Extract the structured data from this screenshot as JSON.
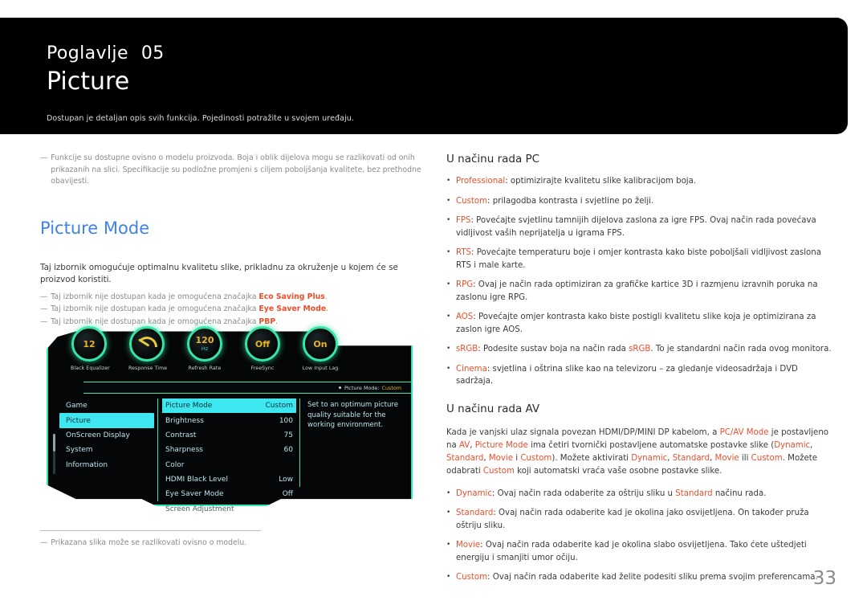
{
  "banner": {
    "chapter_label": "Poglavlje",
    "chapter_number": "05",
    "title": "Picture",
    "subtitle": "Dostupan je detaljan opis svih funkcija. Pojedinosti potražite u svojem uređaju."
  },
  "left": {
    "intro_note": "Funkcije su dostupne ovisno o modelu proizvoda. Boja i oblik dijelova mogu se razlikovati od onih prikazanih na slici. Specifikacije su podložne promjeni s ciljem poboljšanja kvalitete, bez prethodne obavijesti.",
    "section_title": "Picture Mode",
    "section_para": "Taj izbornik omogućuje optimalnu kvalitetu slike, prikladnu za okruženje u kojem će se proizvod koristiti.",
    "notes": [
      {
        "prefix": "Taj izbornik nije dostupan kada je omogućena značajka ",
        "highlight": "Eco Saving Plus",
        "suffix": "."
      },
      {
        "prefix": "Taj izbornik nije dostupan kada je omogućena značajka ",
        "highlight": "Eye Saver Mode",
        "suffix": "."
      },
      {
        "prefix": "Taj izbornik nije dostupan kada je omogućena značajka ",
        "highlight": "PBP",
        "suffix": "."
      }
    ],
    "figure_note": "Prikazana slika može se razlikovati ovisno o modelu.",
    "dash": "—"
  },
  "osd": {
    "gauges": [
      {
        "label": "Black Equalizer",
        "value": "12",
        "unit": "",
        "type": "value"
      },
      {
        "label": "Response Time",
        "value": "",
        "unit": "",
        "type": "needle"
      },
      {
        "label": "Refresh Rate",
        "value": "120",
        "unit": "Hz",
        "type": "value"
      },
      {
        "label": "FreeSync",
        "value": "Off",
        "unit": "",
        "type": "value"
      },
      {
        "label": "Low Input Lag",
        "value": "On",
        "unit": "",
        "type": "value"
      }
    ],
    "status": {
      "label": "Picture Mode:",
      "value": "Custom"
    },
    "menu_items": [
      {
        "label": "Game",
        "selected": false
      },
      {
        "label": "Picture",
        "selected": true
      },
      {
        "label": "OnScreen Display",
        "selected": false
      },
      {
        "label": "System",
        "selected": false
      },
      {
        "label": "Information",
        "selected": false
      }
    ],
    "options": [
      {
        "label": "Picture Mode",
        "value": "Custom",
        "selected": true,
        "dim": false
      },
      {
        "label": "Brightness",
        "value": "100",
        "selected": false,
        "dim": false
      },
      {
        "label": "Contrast",
        "value": "75",
        "selected": false,
        "dim": false
      },
      {
        "label": "Sharpness",
        "value": "60",
        "selected": false,
        "dim": false
      },
      {
        "label": "Color",
        "value": "",
        "selected": false,
        "dim": false
      },
      {
        "label": "HDMI Black Level",
        "value": "Low",
        "selected": false,
        "dim": false
      },
      {
        "label": "Eye Saver Mode",
        "value": "Off",
        "selected": false,
        "dim": false
      },
      {
        "label": "Screen Adjustment",
        "value": "",
        "selected": false,
        "dim": true
      }
    ],
    "description": "Set to an optimum picture quality suitable for the working environment."
  },
  "right": {
    "pc_heading": "U načinu rada PC",
    "pc_bullets": [
      {
        "term": "Professional",
        "text": ": optimizirajte kvalitetu slike kalibracijom boja."
      },
      {
        "term": "Custom",
        "text": ": prilagodba kontrasta i svjetline po želji."
      },
      {
        "term": "FPS",
        "text": ": Povećajte svjetlinu tamnijih dijelova zaslona za igre FPS. Ovaj način rada povećava vidljivost vaših neprijatelja u igrama FPS."
      },
      {
        "term": "RTS",
        "text": ": Povećajte temperaturu boje i omjer kontrasta kako biste poboljšali vidljivost zaslona RTS i male karte."
      },
      {
        "term": "RPG",
        "text": ": Ovaj je način rada optimiziran za grafičke kartice 3D i razmjenu izravnih poruka na zaslonu igre RPG."
      },
      {
        "term": "AOS",
        "text": ": Povećajte omjer kontrasta kako biste postigli kvalitetu slike koja je optimizirana za zaslon igre AOS."
      },
      {
        "term": "sRGB",
        "text": ": Podesite sustav boja na način rada sRGB. To je standardni način rada ovog monitora."
      },
      {
        "term": "Cinema",
        "text": ": svjetlina i oštrina slike kao na televizoru – za gledanje videosadržaja i DVD sadržaja."
      }
    ],
    "av_heading": "U načinu rada AV",
    "av_para": "Kada je vanjski ulaz signala povezan HDMI/DP/MINI DP kabelom, a PC/AV Mode je postavljeno na AV, Picture Mode ima četiri tvornički postavljene automatske postavke slike (Dynamic, Standard, Movie i Custom). Možete aktivirati Dynamic, Standard, Movie ili Custom. Možete odabrati Custom koji automatski vraća vaše osobne postavke slike.",
    "av_bullets": [
      {
        "term": "Dynamic",
        "text": ": Ovaj način rada odaberite za oštriju sliku u Standard načinu rada."
      },
      {
        "term": "Standard",
        "text": ": Ovaj način rada odaberite kad je okolina jako osvijetljena. On također pruža oštriju sliku."
      },
      {
        "term": "Movie",
        "text": ": Ovaj način rada odaberite kad je okolina slabo osvijetljena. Tako ćete uštedjeti energiju i smanjiti umor očiju."
      },
      {
        "term": "Custom",
        "text": ": Ovaj način rada odaberite kad želite podesiti sliku prema svojim preferencama."
      }
    ],
    "bullet_glyph": "•"
  },
  "page_number": "33",
  "colors": {
    "accent_blue": "#3f82e8",
    "highlight_red": "#ef4d2a",
    "osd_green": "#2fe6b4",
    "osd_cyan": "#3ee6f0",
    "osd_gold": "#e8b52a"
  }
}
